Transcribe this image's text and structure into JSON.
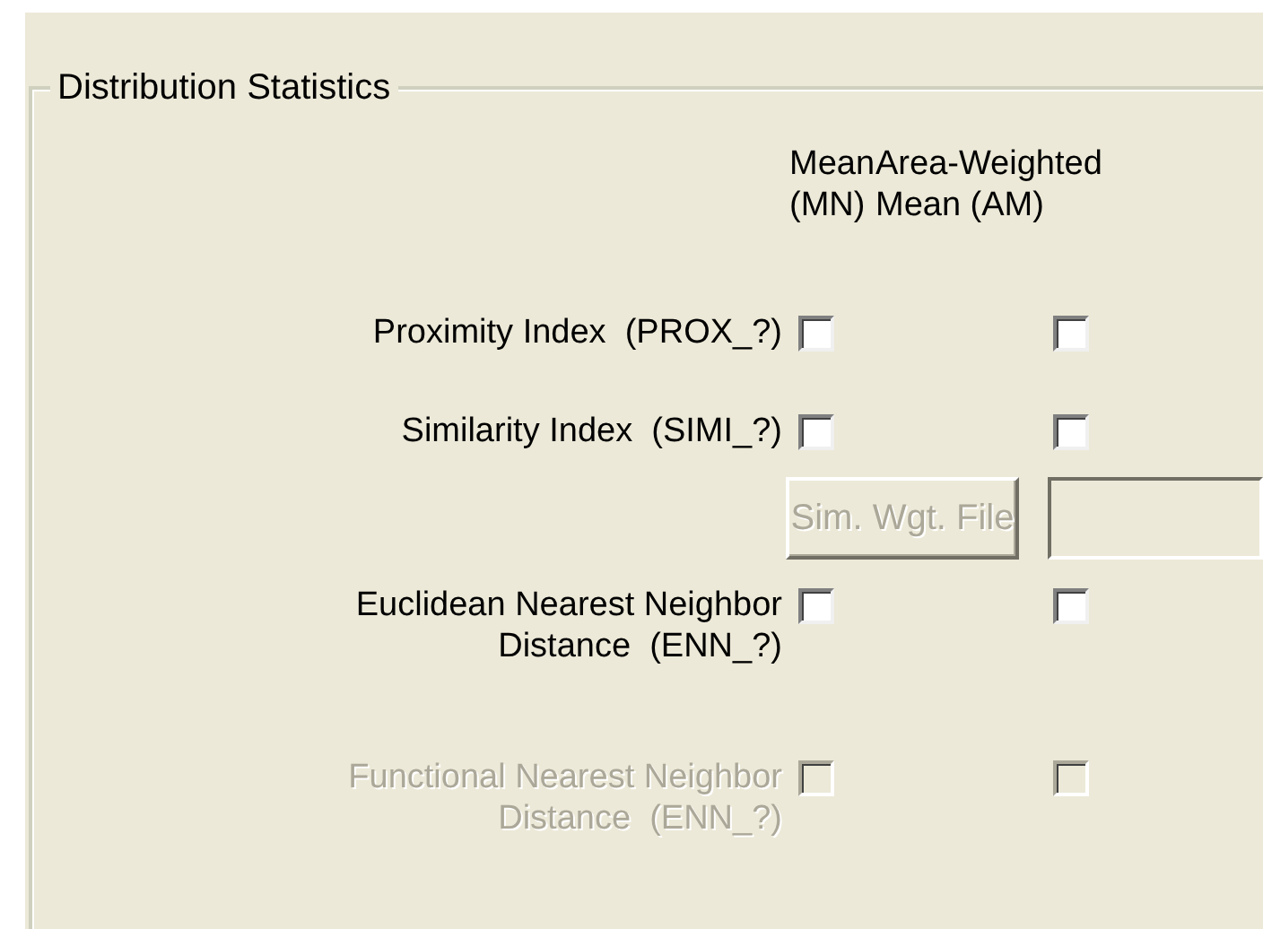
{
  "group": {
    "title": "Distribution Statistics",
    "columns": [
      {
        "label": "Mean\n(MN)"
      },
      {
        "label": "Area-Weighted\nMean (AM)"
      }
    ],
    "rows": [
      {
        "kind": "metric",
        "label": "Proximity Index  (PROX_?)",
        "disabled": false,
        "checks": [
          {
            "checked": false
          },
          {
            "checked": false
          }
        ]
      },
      {
        "kind": "metric",
        "label": "Similarity Index  (SIMI_?)",
        "disabled": false,
        "checks": [
          {
            "checked": false
          },
          {
            "checked": false
          }
        ]
      },
      {
        "kind": "file",
        "button": "Sim. Wgt. File",
        "disabled": true
      },
      {
        "kind": "metric",
        "label": "Euclidean Nearest Neighbor\nDistance  (ENN_?)",
        "disabled": false,
        "checks": [
          {
            "checked": false
          },
          {
            "checked": false
          }
        ]
      },
      {
        "kind": "metric",
        "label": "Functional Nearest Neighbor\nDistance  (ENN_?)",
        "disabled": true,
        "checks": [
          {
            "checked": false
          },
          {
            "checked": false
          }
        ]
      }
    ]
  }
}
